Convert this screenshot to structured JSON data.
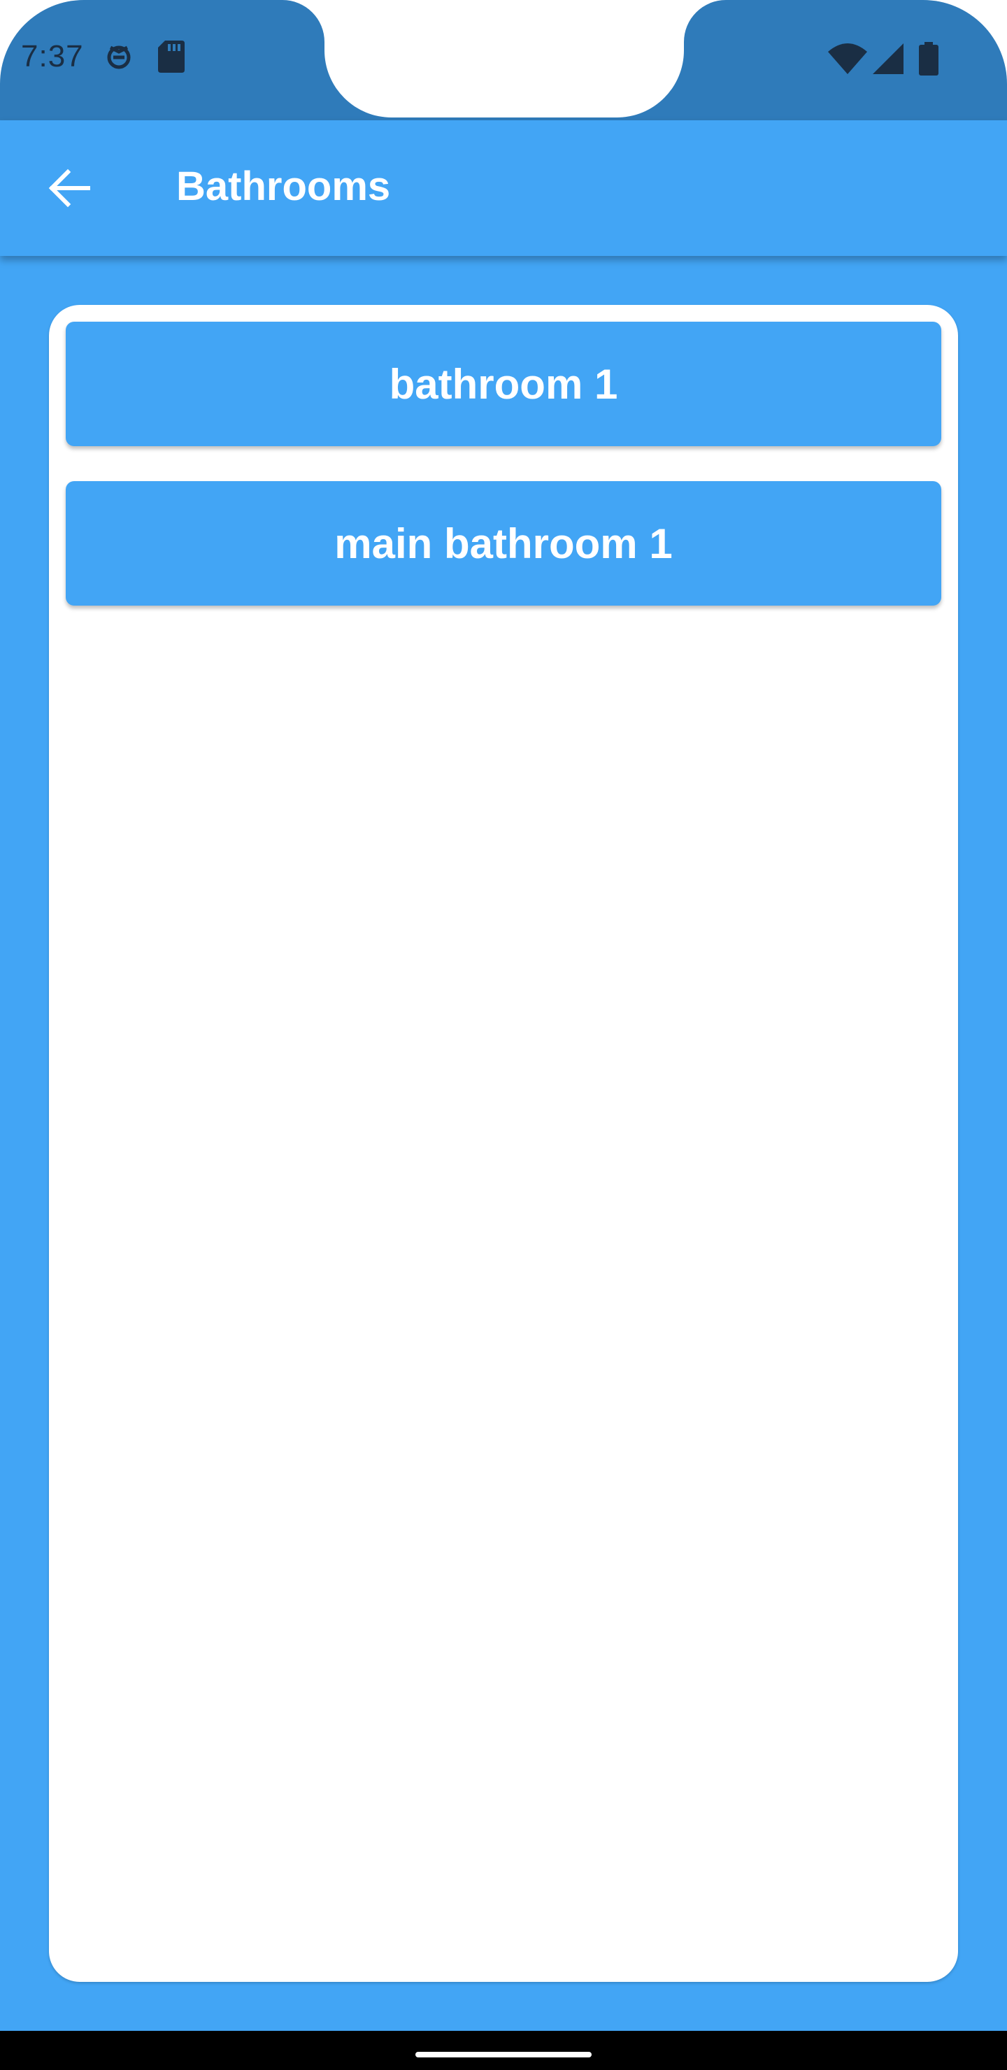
{
  "status_bar": {
    "time": "7:37",
    "left_icons": [
      "vpn-key-icon",
      "sd-card-icon"
    ],
    "right_icons": [
      "wifi-icon",
      "cell-signal-icon",
      "battery-icon"
    ]
  },
  "app_bar": {
    "back_icon": "arrow-back-icon",
    "title": "Bathrooms"
  },
  "rooms": [
    {
      "label": "bathroom 1"
    },
    {
      "label": "main bathroom 1"
    }
  ],
  "colors": {
    "primary": "#42A5F5",
    "status_bar": "#2F7BBA",
    "card": "#FFFFFF",
    "text_on_primary": "#FFFFFF"
  }
}
